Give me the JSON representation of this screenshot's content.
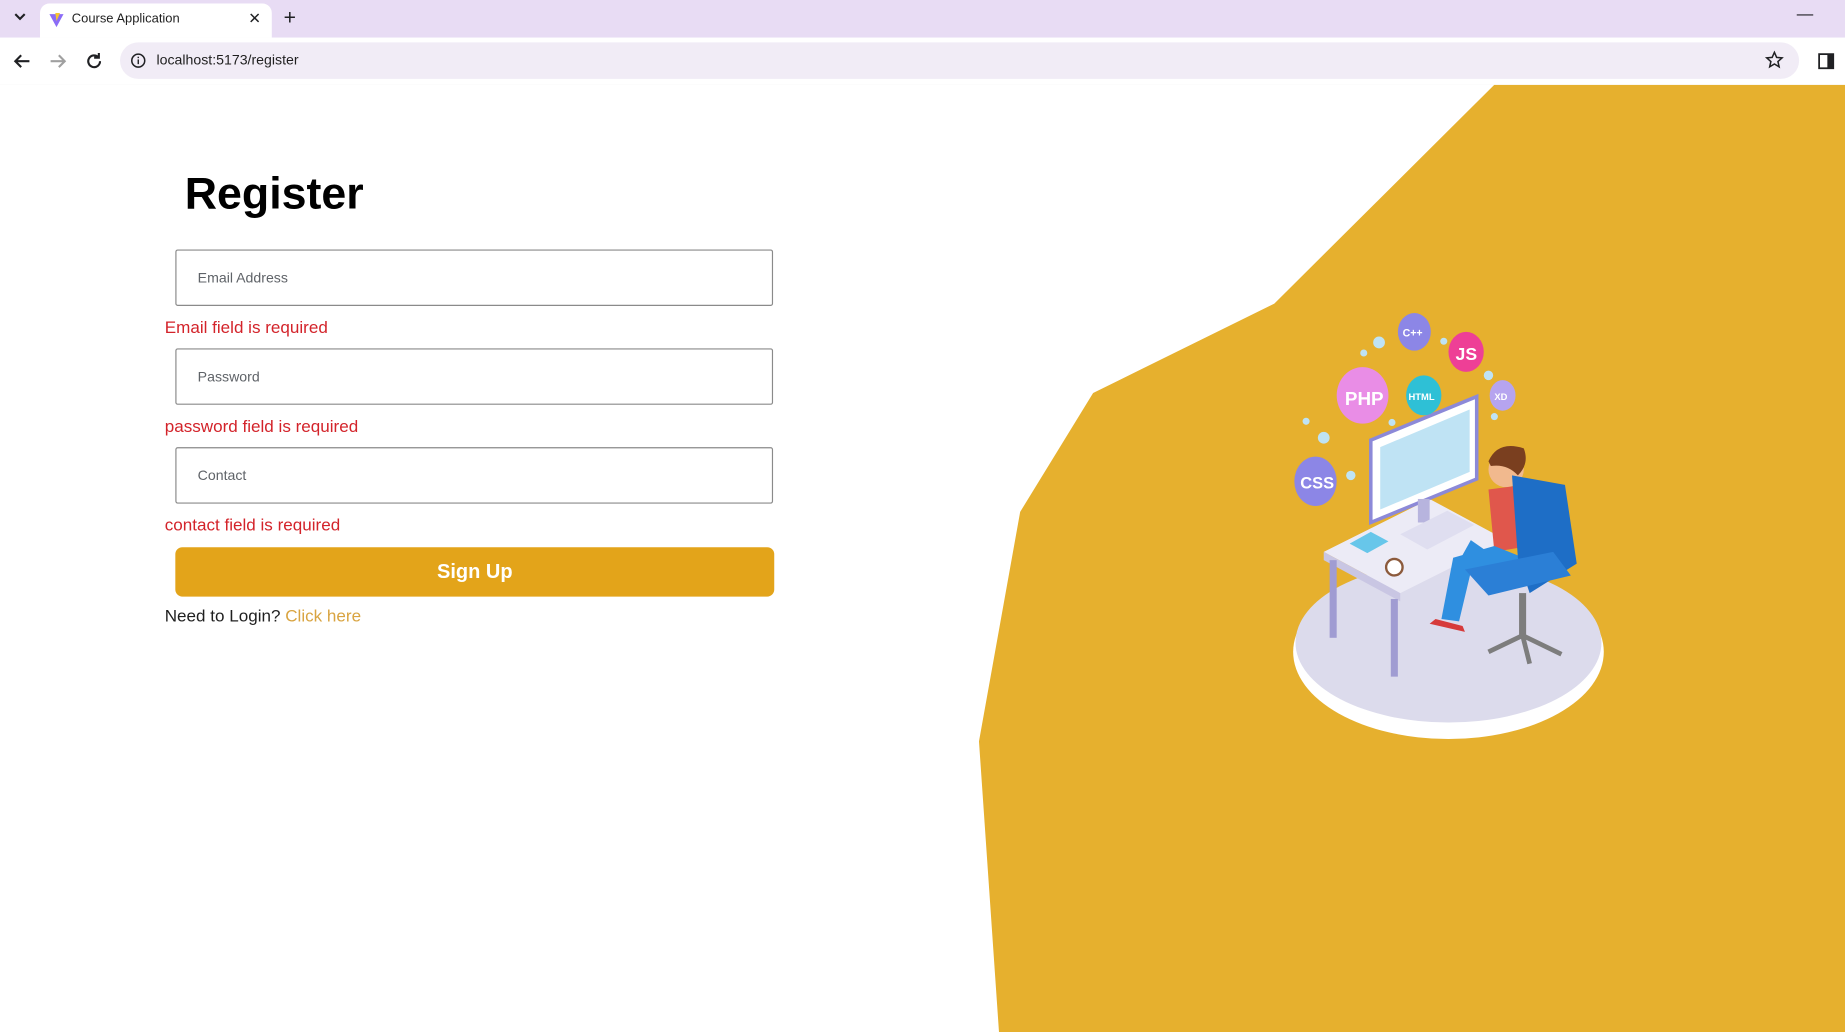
{
  "browser": {
    "tab_title": "Course Application",
    "url": "localhost:5173/register"
  },
  "form": {
    "heading": "Register",
    "email_placeholder": "Email Address",
    "email_error": "Email field is required",
    "password_placeholder": "Password",
    "password_error": "password field is required",
    "contact_placeholder": "Contact",
    "contact_error": "contact field is required",
    "submit_label": "Sign Up",
    "login_prompt": "Need to Login?",
    "login_link": "Click here"
  },
  "illustration": {
    "badges": [
      "PHP",
      "C++",
      "JS",
      "HTML",
      "XD",
      "CSS"
    ]
  },
  "colors": {
    "accent": "#e3a41a",
    "background_shape": "#e6b02e",
    "error": "#d3232a",
    "link": "#d9a441"
  }
}
